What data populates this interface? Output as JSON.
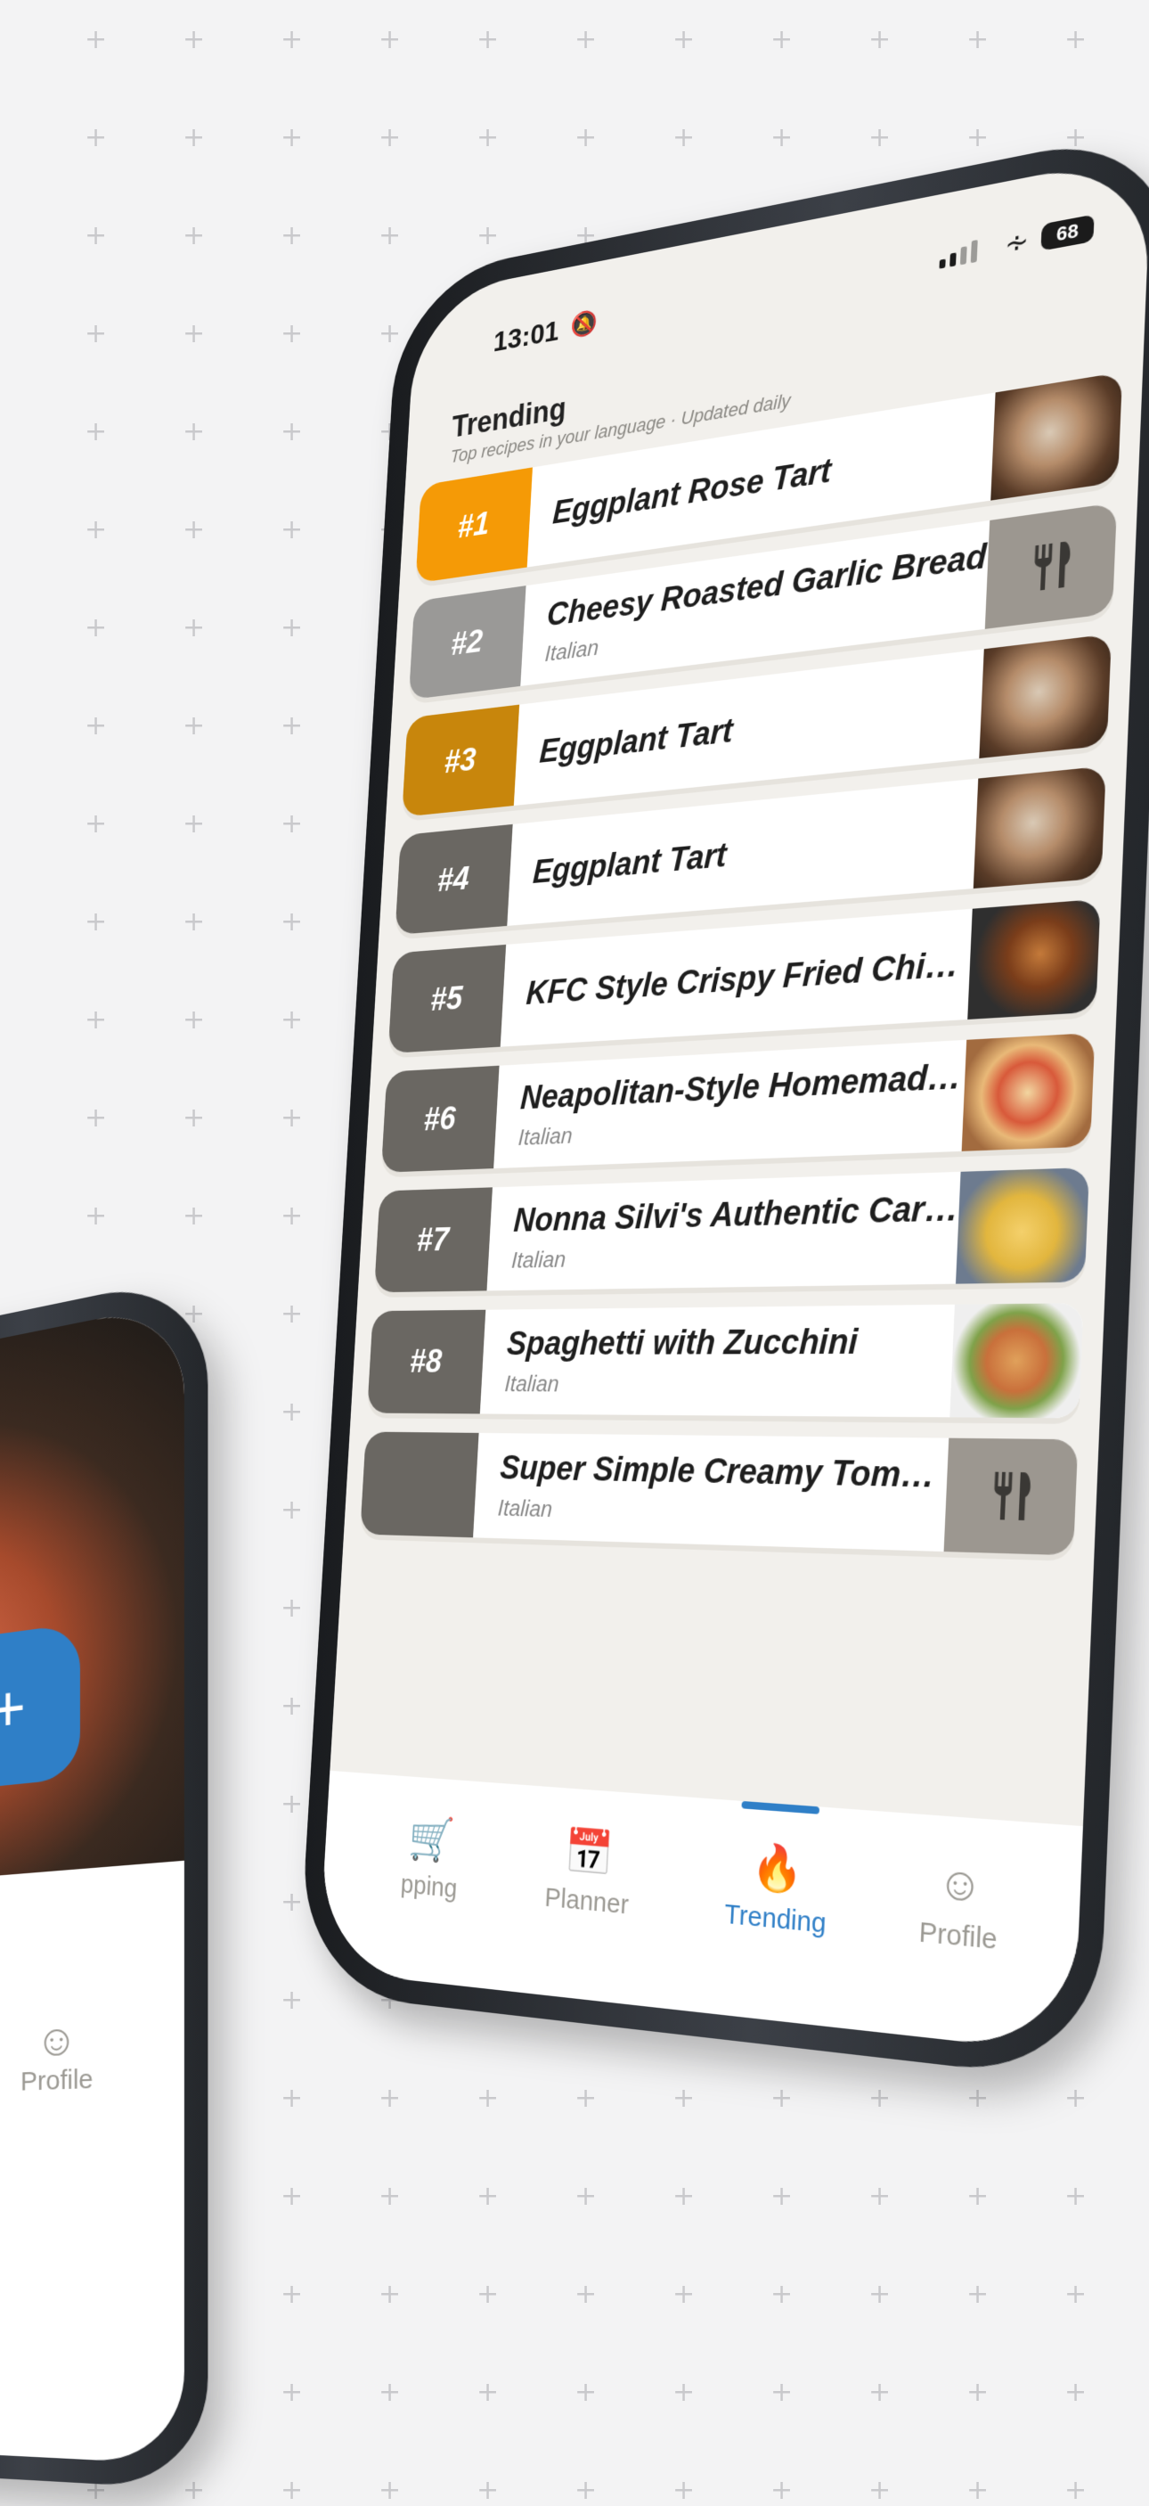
{
  "status": {
    "time": "13:01",
    "battery": "68"
  },
  "header": {
    "title": "Trending",
    "subtitle": "Top recipes in your language · Updated daily"
  },
  "recipes": [
    {
      "rank": "#1",
      "name": "Eggplant Rose Tart",
      "category": "",
      "rank_color": "#f59a06",
      "thumb": "photo"
    },
    {
      "rank": "#2",
      "name": "Cheesy Roasted Garlic Bread",
      "category": "Italian",
      "rank_color": "#9a9997",
      "thumb": "fork"
    },
    {
      "rank": "#3",
      "name": "Eggplant Tart",
      "category": "",
      "rank_color": "#c8860c",
      "thumb": "photo"
    },
    {
      "rank": "#4",
      "name": "Eggplant Tart",
      "category": "",
      "rank_color": "#6a6762",
      "thumb": "photo"
    },
    {
      "rank": "#5",
      "name": "KFC Style Crispy Fried Chicken",
      "category": "",
      "rank_color": "#6a6762",
      "thumb": "chicken"
    },
    {
      "rank": "#6",
      "name": "Neapolitan-Style Homemade ...",
      "category": "Italian",
      "rank_color": "#6a6762",
      "thumb": "pizza"
    },
    {
      "rank": "#7",
      "name": "Nonna Silvi's Authentic Carbo...",
      "category": "Italian",
      "rank_color": "#6a6762",
      "thumb": "pasta"
    },
    {
      "rank": "#8",
      "name": "Spaghetti with Zucchini",
      "category": "Italian",
      "rank_color": "#6a6762",
      "thumb": "spag"
    },
    {
      "rank": "",
      "name": "Super Simple Creamy Tomato ...",
      "category": "Italian",
      "rank_color": "#6a6762",
      "thumb": "fork"
    }
  ],
  "tabs": [
    {
      "label": "pping",
      "icon": "cart-icon",
      "active": false
    },
    {
      "label": "Planner",
      "icon": "calendar-icon",
      "active": false
    },
    {
      "label": "Trending",
      "icon": "flame-icon",
      "active": true
    },
    {
      "label": "Profile",
      "icon": "person-icon",
      "active": false
    }
  ],
  "back_phone": {
    "fab": "+",
    "profile_label": "Profile"
  },
  "colors": {
    "accent": "#2f7fc7",
    "gold": "#f59a06",
    "bronze": "#c8860c",
    "silver": "#9a9997"
  }
}
